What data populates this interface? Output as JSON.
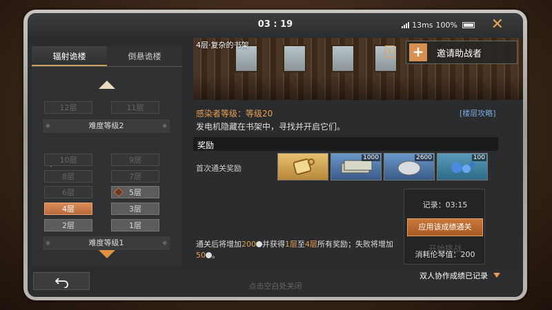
{
  "statusbar": {
    "clock": "03 : 19",
    "ping": "13ms",
    "battery": "100%",
    "close_glyph": "✕"
  },
  "tabs": [
    {
      "label": "辐射诡楼",
      "active": true
    },
    {
      "label": "倒悬诡楼",
      "active": false
    }
  ],
  "floors": {
    "f12": "12层",
    "f11": "11层",
    "difficulty2": "难度等级2",
    "f10": "10层",
    "f9": "9层",
    "f8": "8层",
    "f7": "7层",
    "f6": "6层",
    "f5": "5层",
    "f4": "4层",
    "f3": "3层",
    "f2": "2层",
    "f1": "1层",
    "difficulty1": "难度等级1"
  },
  "banner": {
    "title": "4层·复杂的书架",
    "info_glyph": "i",
    "invite_label": "邀请助战者"
  },
  "details": {
    "infected_level": "感染者等级：等级20",
    "strategy_link": "[楼层攻略]",
    "description": "发电机隐藏在书架中，寻找并开启它们。",
    "rewards_header": "奖励",
    "first_clear_label": "首次通关奖励"
  },
  "rewards": [
    {
      "name": "gold-token",
      "qty": ""
    },
    {
      "name": "cash-bundle",
      "qty": "1000"
    },
    {
      "name": "silver-ore",
      "qty": "2600"
    },
    {
      "name": "blue-crystals",
      "qty": "100"
    }
  ],
  "record": {
    "record_text": "记录：03:15",
    "apply_label": "应用该成绩通关",
    "start_ghost": "开始挑战",
    "cost_text": "消耗伦琴值：200"
  },
  "footnote": {
    "p1": "通关后将增加",
    "n1": "200",
    "p2": "并获得",
    "f_from": "1层",
    "p3": "至",
    "f_to": "4层",
    "p4": "所有奖励；失败将增加",
    "n2": "50",
    "p5": "。"
  },
  "bottom": {
    "close_hint": "点击空白处关闭",
    "coop_text": "双人协作成绩已记录"
  },
  "colors": {
    "accent": "#e8a050",
    "link": "#7aa8e0",
    "current_floor": "#d88c5a"
  }
}
